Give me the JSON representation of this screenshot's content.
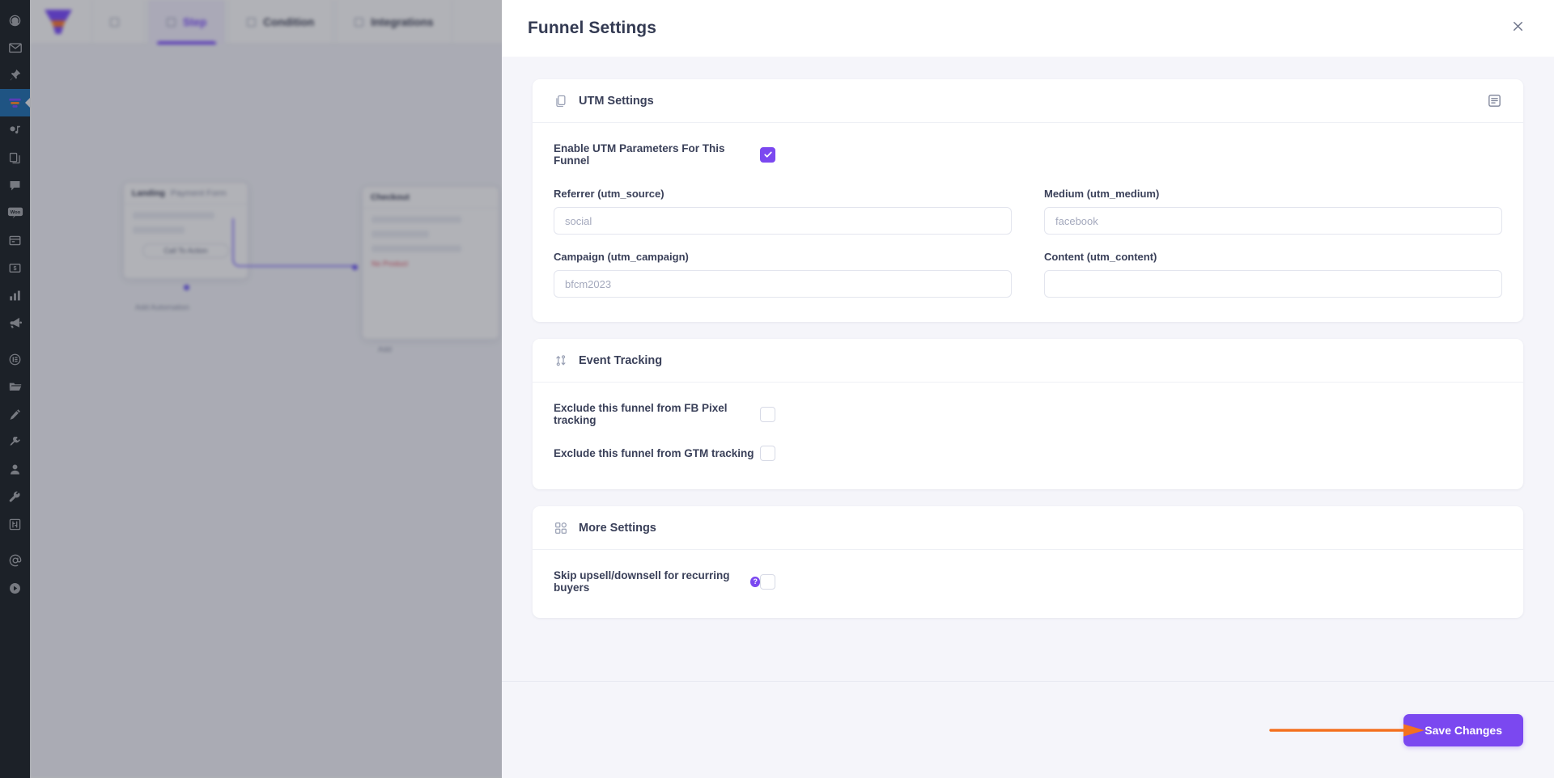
{
  "wp_sidebar": {
    "items": [
      {
        "name": "dashboard",
        "icon": "gauge-icon"
      },
      {
        "name": "mail",
        "icon": "envelope-icon"
      },
      {
        "name": "posts",
        "icon": "pin-icon"
      },
      {
        "name": "funnels",
        "icon": "funnel-icon",
        "active": true
      },
      {
        "name": "media",
        "icon": "media-icon"
      },
      {
        "name": "pages",
        "icon": "pages-icon"
      },
      {
        "name": "comments",
        "icon": "comment-icon"
      },
      {
        "name": "woocommerce",
        "icon": "woo-icon"
      },
      {
        "name": "products",
        "icon": "archive-icon"
      },
      {
        "name": "payments",
        "icon": "money-icon"
      },
      {
        "name": "analytics",
        "icon": "bar-chart-icon"
      },
      {
        "name": "marketing",
        "icon": "megaphone-icon"
      },
      {
        "name": "elementor",
        "icon": "elementor-icon"
      },
      {
        "name": "templates",
        "icon": "folder-icon"
      },
      {
        "name": "appearance",
        "icon": "brush-icon"
      },
      {
        "name": "plugins",
        "icon": "plug-icon"
      },
      {
        "name": "users",
        "icon": "user-icon"
      },
      {
        "name": "tools",
        "icon": "wrench-icon"
      },
      {
        "name": "settings",
        "icon": "sliders-icon"
      },
      {
        "name": "mentions",
        "icon": "at-icon"
      },
      {
        "name": "player",
        "icon": "play-icon"
      }
    ]
  },
  "background": {
    "logo": "funnel-logo",
    "tabs": [
      {
        "label": "",
        "icon": "id-icon",
        "selected": false
      },
      {
        "label": "Step",
        "icon": "square-icon",
        "selected": true
      },
      {
        "label": "Condition",
        "icon": "square-icon",
        "selected": false
      },
      {
        "label": "Integrations",
        "icon": "square-icon",
        "selected": false
      }
    ],
    "nodes": [
      {
        "title": "Landing",
        "subtitle": "Payment Form",
        "cta": "Call To Action",
        "caption": "Add Automation"
      },
      {
        "title": "Checkout",
        "error": "No Product",
        "caption": "Add"
      }
    ]
  },
  "drawer": {
    "title": "Funnel Settings",
    "close_label": "Close",
    "sections": [
      {
        "id": "utm",
        "title": "UTM Settings",
        "icon": "copy-icon",
        "action_icon": "note-icon",
        "toggle": {
          "label": "Enable UTM Parameters For This Funnel",
          "checked": true
        },
        "fields": [
          {
            "label": "Referrer (utm_source)",
            "name": "utm-source-input",
            "value": "",
            "placeholder": "social",
            "focused": false
          },
          {
            "label": "Medium (utm_medium)",
            "name": "utm-medium-input",
            "value": "",
            "placeholder": "facebook",
            "focused": false
          },
          {
            "label": "Campaign (utm_campaign)",
            "name": "utm-campaign-input",
            "value": "",
            "placeholder": "bfcm2023",
            "focused": false
          },
          {
            "label": "Content (utm_content)",
            "name": "utm-content-input",
            "value": "",
            "placeholder": "",
            "focused": true
          }
        ]
      },
      {
        "id": "event-tracking",
        "title": "Event Tracking",
        "icon": "shuffle-icon",
        "checkboxes": [
          {
            "label": "Exclude this funnel from FB Pixel tracking",
            "name": "exclude-fb-pixel-checkbox",
            "checked": false,
            "help": false
          },
          {
            "label": "Exclude this funnel from GTM tracking",
            "name": "exclude-gtm-checkbox",
            "checked": false,
            "help": false
          }
        ]
      },
      {
        "id": "more-settings",
        "title": "More Settings",
        "icon": "grid-icon",
        "checkboxes": [
          {
            "label": "Skip upsell/downsell for recurring buyers",
            "name": "skip-upsell-checkbox",
            "checked": false,
            "help": true,
            "help_glyph": "?"
          }
        ]
      }
    ],
    "footer": {
      "save_label": "Save Changes"
    }
  },
  "annotation": {
    "arrow_color": "#f4711f",
    "points_to": "Save Changes"
  },
  "colors": {
    "accent": "#7b48f0",
    "arrow": "#f4711f",
    "text": "#3a4059",
    "panel_bg": "#f5f5fa",
    "card_bg": "#ffffff"
  }
}
